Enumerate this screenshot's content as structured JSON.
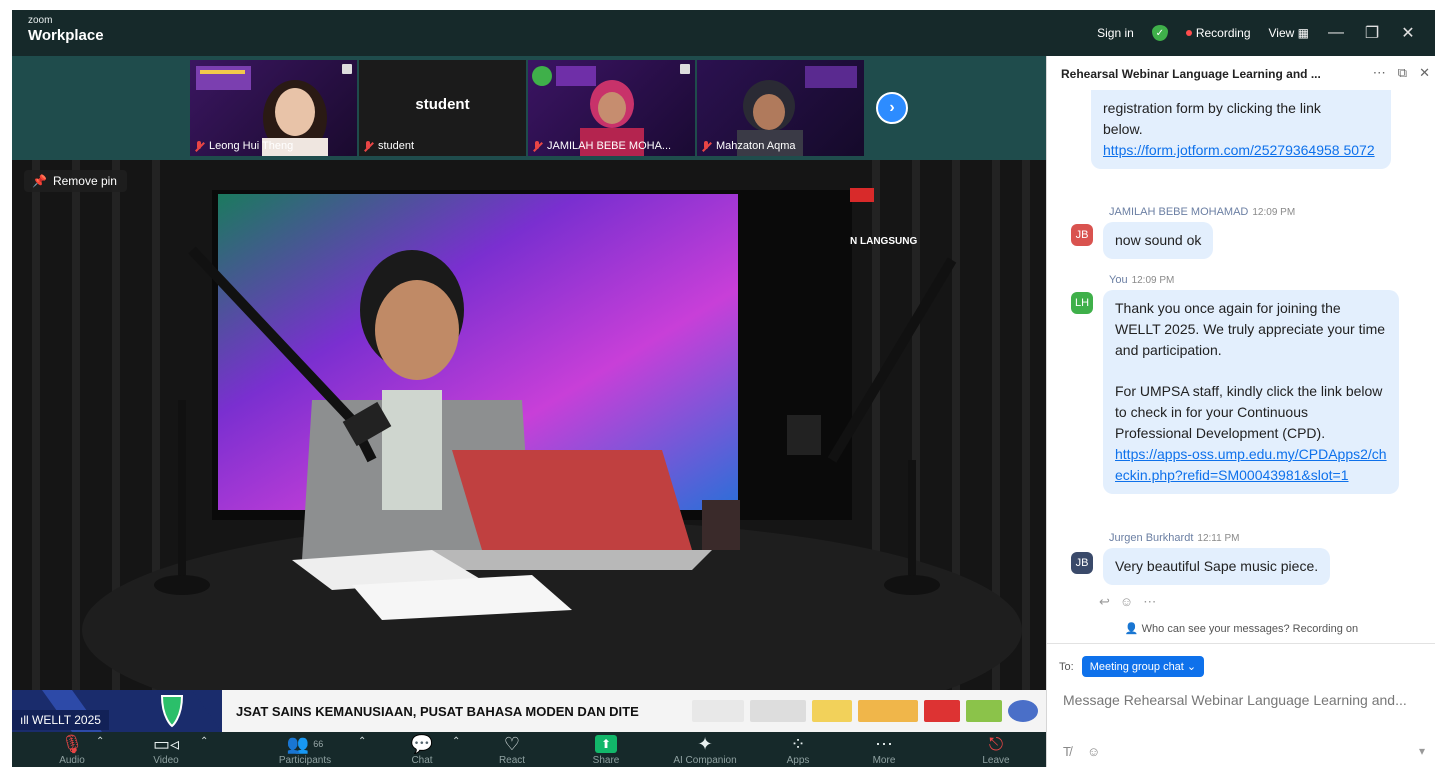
{
  "titlebar": {
    "brand_small": "zoom",
    "brand_large": "Workplace",
    "sign_in": "Sign in",
    "recording": "Recording",
    "view": "View"
  },
  "gallery": {
    "participants": [
      {
        "name": "Leong Hui Theng",
        "bg": "#2a1240"
      },
      {
        "name": "student",
        "label": "student",
        "bg": "#1b1b1b"
      },
      {
        "name": "JAMILAH BEBE MOHA...",
        "bg": "#2c1040"
      },
      {
        "name": "Mahzaton Aqma",
        "bg": "#21103a"
      }
    ]
  },
  "stage": {
    "remove_pin": "Remove pin",
    "lower_third_tag": "WELLT 2025",
    "ticker": "JSAT SAINS KEMANUSIAAN, PUSAT BAHASA MODEN DAN DITE",
    "screen_text": "N LANGSUNG"
  },
  "toolbar": {
    "audio": "Audio",
    "video": "Video",
    "participants": "Participants",
    "participant_count": "66",
    "chat": "Chat",
    "react": "React",
    "share": "Share",
    "ai_companion": "AI Companion",
    "apps": "Apps",
    "more": "More",
    "leave": "Leave"
  },
  "chat": {
    "title": "Rehearsal Webinar Language Learning and ...",
    "messages": [
      {
        "text_lines": [
          "registration form by clicking the link",
          "below."
        ],
        "link": "https://form.jotform.com/25279364958 5072"
      },
      {
        "sender": "JAMILAH BEBE MOHAMAD",
        "time": "12:09 PM",
        "initials": "JB",
        "text": "now sound ok"
      },
      {
        "sender": "You",
        "time": "12:09 PM",
        "initials": "LH",
        "p1": "Thank you once again for joining the WELLT 2025. We truly appreciate your time and participation.",
        "p2": "For UMPSA staff, kindly click the link below to check in for your Continuous Professional Development (CPD).",
        "link": "https://apps-oss.ump.edu.my/CPDApps2/checkin.php?refid=SM00043981&slot=1"
      },
      {
        "sender": "Jurgen Burkhardt",
        "time": "12:11 PM",
        "initials": "JB",
        "text": "Very beautiful Sape music piece."
      }
    ],
    "visibility_note": "Who can see your messages? Recording on",
    "to_label": "To:",
    "recipient": "Meeting group chat",
    "input_placeholder": "Message Rehearsal Webinar Language Learning and..."
  },
  "colors": {
    "accent": "#0e71eb",
    "toolbar_bg": "#16292a",
    "meeting_bg": "#1f4c4c",
    "bubble": "#e3effd",
    "share_green": "#12b76a",
    "recording_red": "#ff4d4d"
  }
}
